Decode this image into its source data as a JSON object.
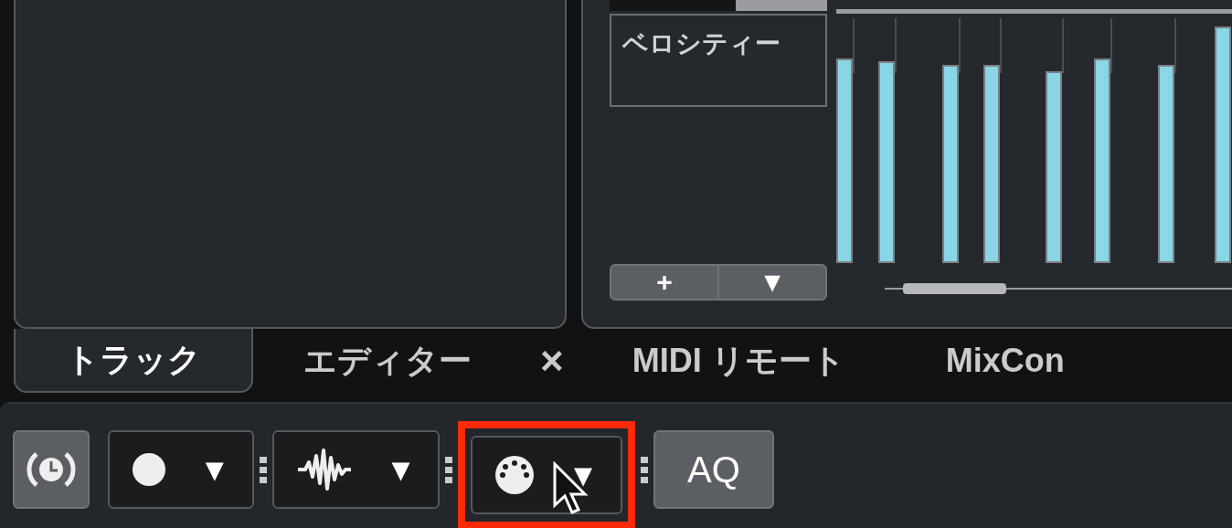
{
  "lane": {
    "label": "ベロシティー",
    "buttons": [
      {
        "label": "+"
      },
      {
        "label": "▼"
      }
    ]
  },
  "tabs": [
    {
      "label": "トラック",
      "selected": true
    },
    {
      "label": "エディター",
      "selected": false
    }
  ],
  "close": "×",
  "tabs_more": [
    {
      "label": "MIDI リモート",
      "selected": false
    },
    {
      "label": "MixCon",
      "selected": false
    }
  ],
  "toolbar": [
    {
      "kind": "clock",
      "highlighted": false
    },
    {
      "kind": "record",
      "arrow": "▼",
      "highlighted": false
    },
    {
      "kind": "wave",
      "arrow": "▼",
      "highlighted": false
    },
    {
      "kind": "midi",
      "arrow": "▼",
      "highlighted": true
    },
    {
      "kind": "text",
      "label": "AQ",
      "highlighted": false
    }
  ]
}
